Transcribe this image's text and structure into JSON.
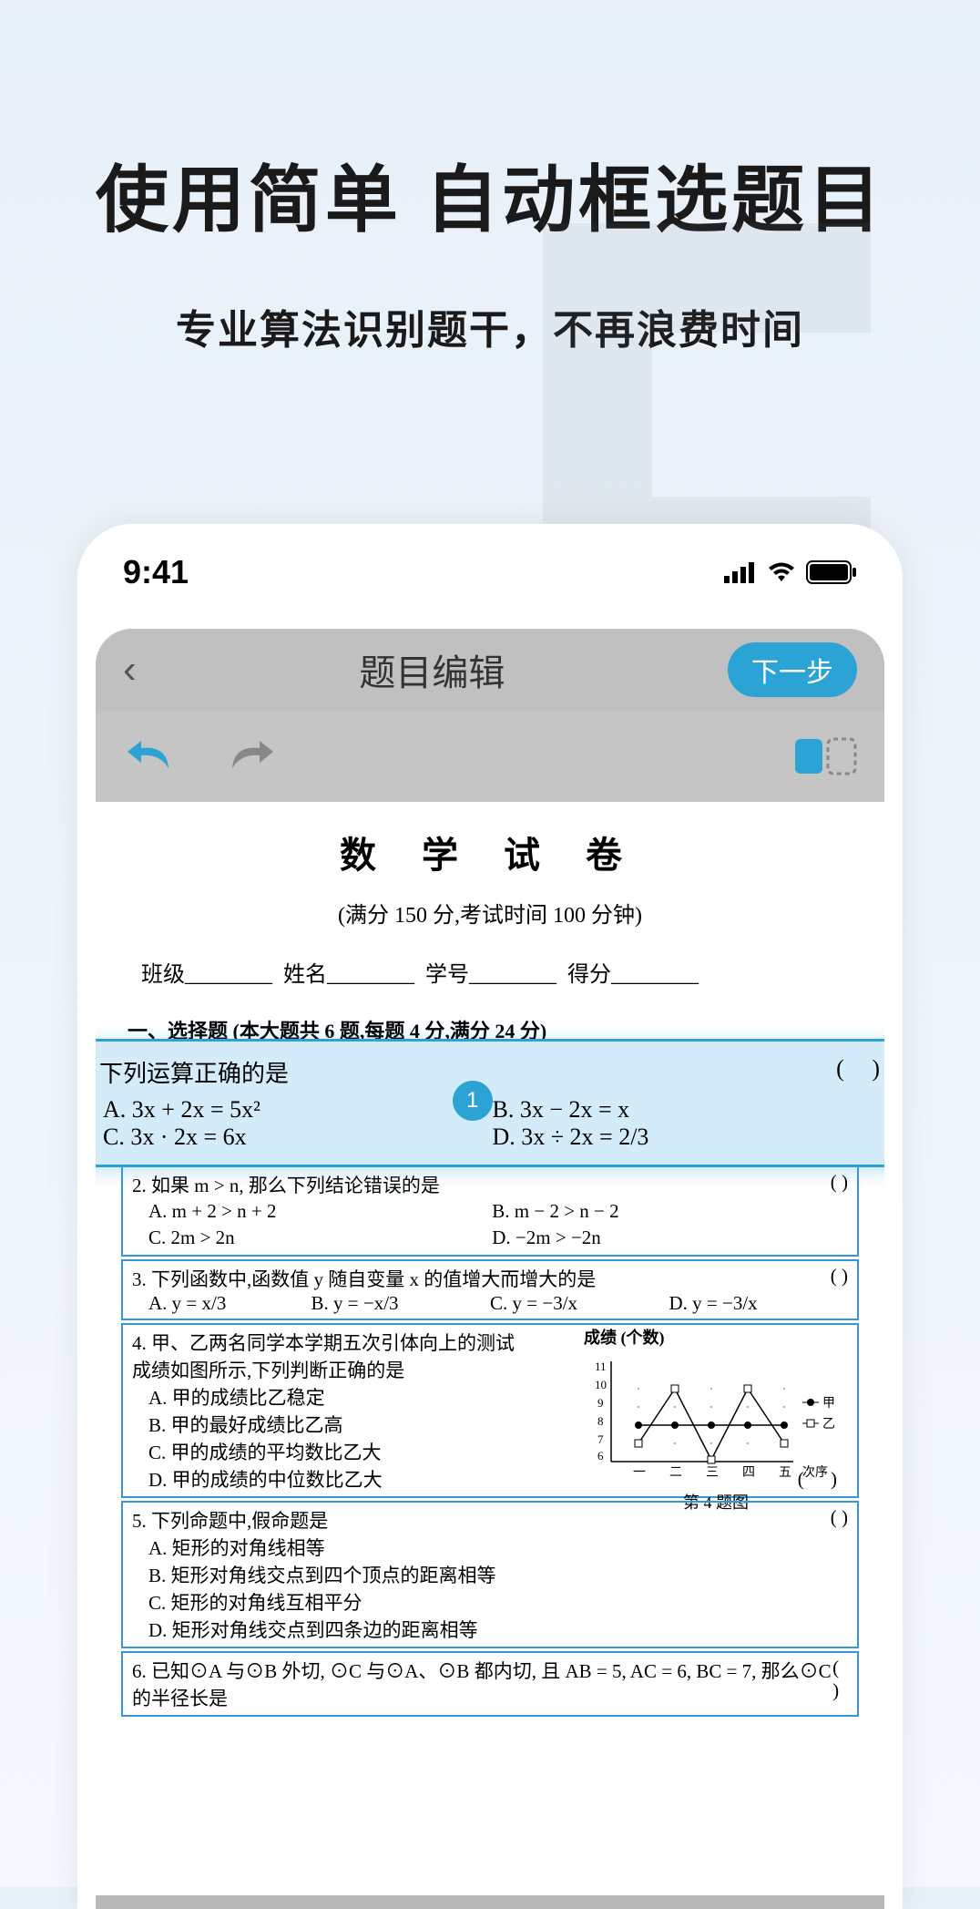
{
  "marketing": {
    "headline": "使用简单 自动框选题目",
    "subheadline": "专业算法识别题干，不再浪费时间"
  },
  "statusBar": {
    "time": "9:41"
  },
  "appHeader": {
    "title": "题目编辑",
    "nextButton": "下一步"
  },
  "paper": {
    "title": "数 学 试 卷",
    "subtitle": "(满分 150 分,考试时间 100 分钟)",
    "infoRow": "班级________  姓名________  学号________  得分________",
    "section1": "一、选择题 (本大题共 6 题,每题 4 分,满分 24 分)"
  },
  "highlightedQ": {
    "number": "1.",
    "text": "下列运算正确的是",
    "badge": "1",
    "optA": "A. 3x + 2x = 5x²",
    "optB": "B. 3x − 2x = x",
    "optC": "C. 3x · 2x = 6x",
    "optD": "D. 3x ÷ 2x = 2/3",
    "paren": "(    )"
  },
  "q2": {
    "text": "2. 如果 m > n, 那么下列结论错误的是",
    "optA": "A. m + 2 > n + 2",
    "optB": "B. m − 2 > n − 2",
    "optC": "C. 2m > 2n",
    "optD": "D. −2m > −2n",
    "paren": "(    )"
  },
  "q3": {
    "text": "3. 下列函数中,函数值 y 随自变量 x 的值增大而增大的是",
    "optA": "A. y = x/3",
    "optB": "B. y = −x/3",
    "optC": "C. y = −3/x",
    "optD": "D. y = −3/x",
    "paren": "(    )"
  },
  "q4": {
    "text": "4. 甲、乙两名同学本学期五次引体向上的测试成绩如图所示,下列判断正确的是",
    "optA": "A. 甲的成绩比乙稳定",
    "optB": "B. 甲的最好成绩比乙高",
    "optC": "C. 甲的成绩的平均数比乙大",
    "optD": "D. 甲的成绩的中位数比乙大",
    "paren": "(    )",
    "chartTitle": "成绩 (个数)",
    "chartCaption": "第 4 题图",
    "legendA": "甲",
    "legendB": "乙"
  },
  "q5": {
    "text": "5. 下列命题中,假命题是",
    "optA": "A. 矩形的对角线相等",
    "optB": "B. 矩形对角线交点到四个顶点的距离相等",
    "optC": "C. 矩形的对角线互相平分",
    "optD": "D. 矩形对角线交点到四条边的距离相等",
    "paren": "(    )"
  },
  "q6": {
    "text": "6. 已知⊙A 与⊙B 外切, ⊙C 与⊙A、⊙B 都内切, 且 AB = 5, AC = 6, BC = 7, 那么⊙C 的半径长是",
    "paren": "(    )"
  },
  "chart_data": {
    "type": "line",
    "title": "成绩 (个数)",
    "xlabel": "次序",
    "ylabel": "个数",
    "categories": [
      "一",
      "二",
      "三",
      "四",
      "五"
    ],
    "series": [
      {
        "name": "甲",
        "marker": "filled-circle",
        "values": [
          8,
          8,
          8,
          8,
          8
        ]
      },
      {
        "name": "乙",
        "marker": "open-square",
        "values": [
          7,
          10,
          6,
          10,
          7
        ]
      }
    ],
    "ylim": [
      6,
      11
    ],
    "yticks": [
      6,
      7,
      8,
      9,
      10,
      11
    ]
  }
}
